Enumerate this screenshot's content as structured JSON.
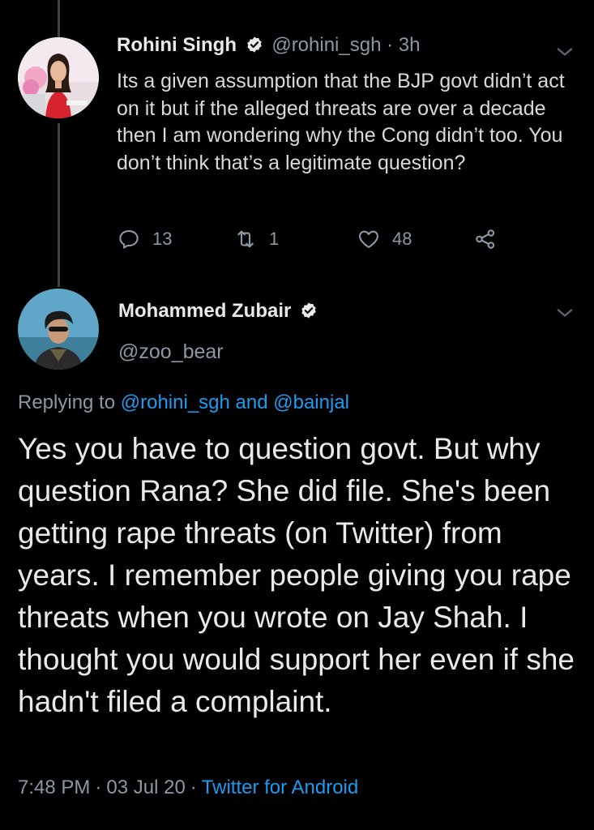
{
  "parent_tweet": {
    "display_name": "Rohini Singh",
    "handle": "@rohini_sgh",
    "separator": "·",
    "time": "3h",
    "text": "Its a given assumption that the BJP govt didn’t act on it but if the alleged threats are over a decade then I am wondering why the Cong didn’t too. You don’t think that’s a legitimate question?",
    "counts": {
      "replies": "13",
      "retweets": "1",
      "likes": "48"
    }
  },
  "reply_tweet": {
    "display_name": "Mohammed Zubair",
    "handle": "@zoo_bear",
    "replying_prefix": "Replying to",
    "replying_user1": "@rohini_sgh",
    "replying_and": "and",
    "replying_user2": "@bainjal",
    "text": "Yes you have to question govt. But why question Rana? She did file. She's been getting rape threats (on Twitter) from years. I remember people giving you rape threats when you wrote on Jay Shah. I thought you would support her even if she hadn't filed a complaint.",
    "time": "7:48 PM",
    "separator": "·",
    "date": "03 Jul 20",
    "source": "Twitter for Android"
  },
  "colors": {
    "background": "#000000",
    "link": "#1d9bf0",
    "muted": "#8b98a5",
    "text": "#e7e9ea"
  },
  "icons": [
    "reply-icon",
    "retweet-icon",
    "like-icon",
    "share-icon",
    "verified-badge-icon",
    "chevron-down-icon"
  ]
}
